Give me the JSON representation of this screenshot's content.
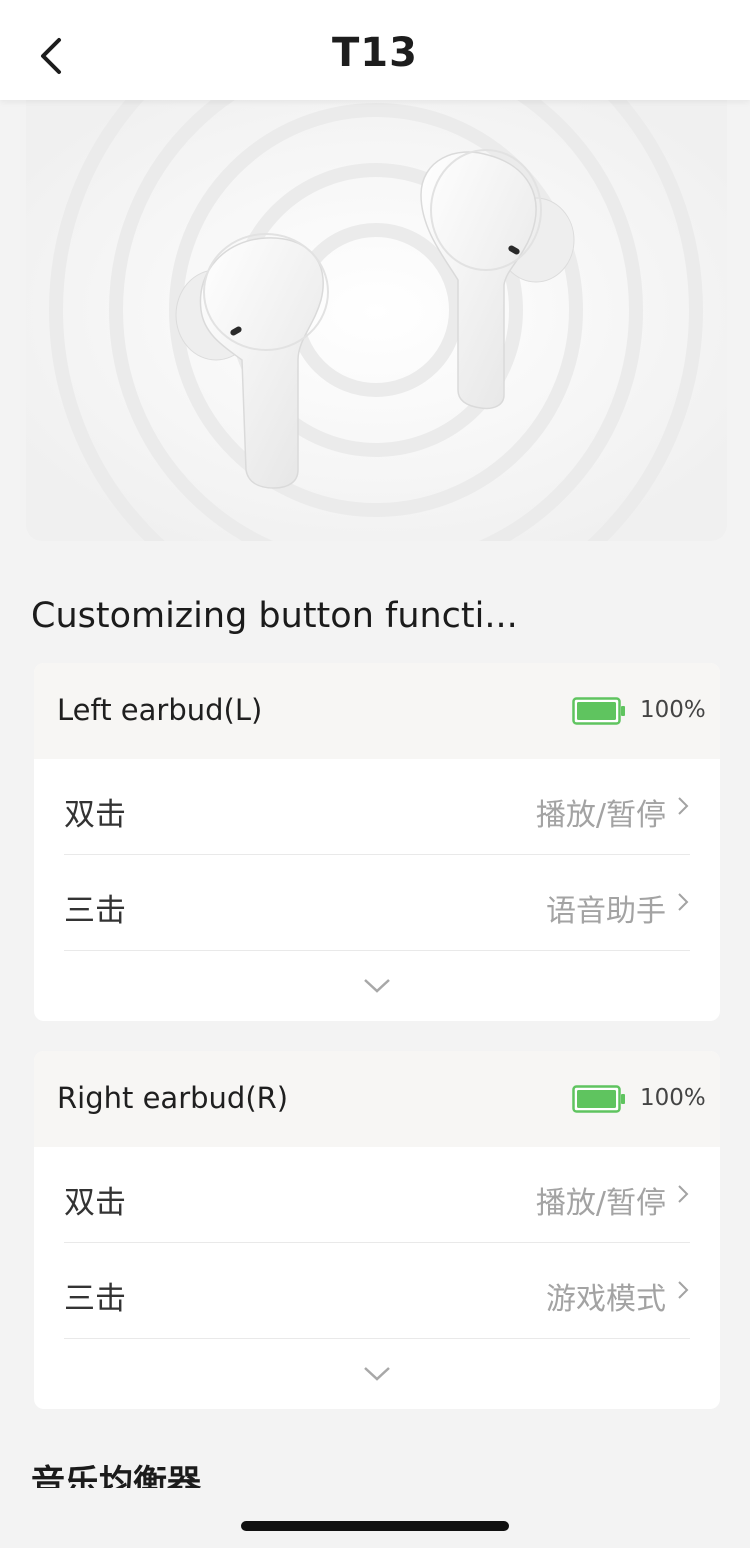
{
  "header": {
    "title": "T13",
    "back_icon": "chevron-left-icon"
  },
  "hero": {
    "image": "earbuds-product-image"
  },
  "section": {
    "title": "Customizing button functi..."
  },
  "left_card": {
    "name": "Left earbud(L)",
    "battery_level": 100,
    "battery_text": "100%",
    "rows": [
      {
        "label": "双击",
        "value": "播放/暂停"
      },
      {
        "label": "三击",
        "value": "语音助手"
      }
    ],
    "expand_icon": "chevron-down-icon"
  },
  "right_card": {
    "name": "Right earbud(R)",
    "battery_level": 100,
    "battery_text": "100%",
    "rows": [
      {
        "label": "双击",
        "value": "播放/暂停"
      },
      {
        "label": "三击",
        "value": "游戏模式"
      }
    ],
    "expand_icon": "chevron-down-icon"
  },
  "equalizer": {
    "title": "音乐均衡器"
  },
  "colors": {
    "battery_green": "#5fc45f",
    "header_bg": "#ffffff",
    "page_bg": "#f3f3f3",
    "value_gray": "#a3a3a3"
  }
}
